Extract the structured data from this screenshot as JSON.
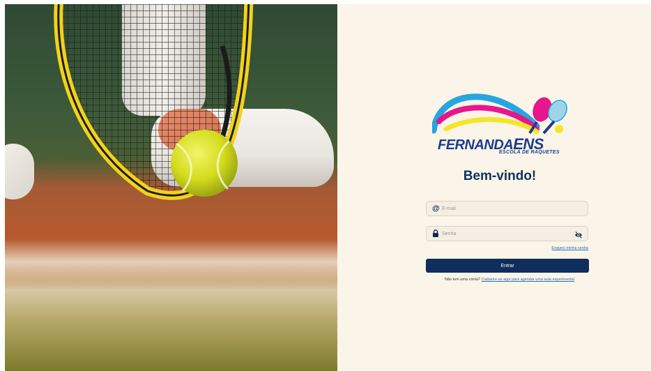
{
  "brand": {
    "name_part1": "FERNANDA",
    "name_part2": "ENS",
    "tagline": "ESCOLA DE RAQUETES"
  },
  "login": {
    "heading": "Bem-vindo!",
    "email_placeholder": "E-mail",
    "password_placeholder": "Senha",
    "forgot_link": "Esqueci minha senha",
    "submit_label": "Entrar",
    "signup_prompt": "Não tem uma conta?",
    "signup_link": "Cadastre-se aqui para agendar uma aula experimental"
  },
  "icons": {
    "email": "at-icon",
    "password": "lock-icon",
    "toggle_visibility": "eye-off-icon"
  },
  "colors": {
    "panel_bg": "#faf5e8",
    "primary": "#0f2e5d",
    "brand_blue": "#1d3c8f",
    "link": "#2b6cb8",
    "ball": "#d9e021",
    "racket": "#f2d21a"
  }
}
